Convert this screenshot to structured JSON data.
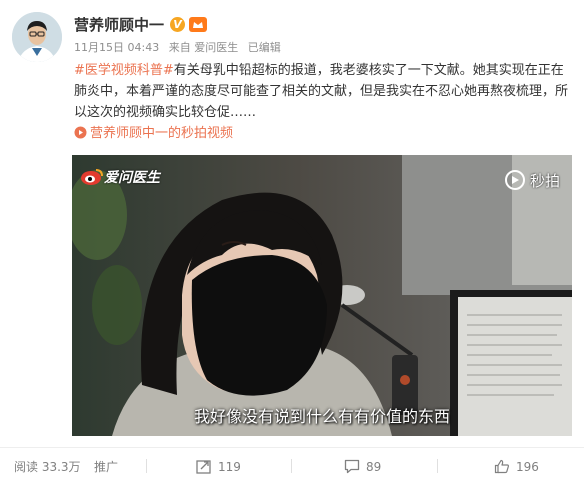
{
  "author": {
    "name": "营养师顾中一",
    "verified_badge": "V"
  },
  "meta": {
    "time": "11月15日 04:43",
    "source": "来自 爱问医生",
    "edited": "已编辑"
  },
  "post": {
    "tag": "#医学视频科普#",
    "text": "有关母乳中铅超标的报道，我老婆核实了一下文献。她其实现在正在肺炎中，本着严谨的态度尽可能查了相关的文献，但是我实在不忍心她再熬夜梳理，所以这次的视频确实比较仓促……",
    "video_link": "营养师顾中一的秒拍视频"
  },
  "video": {
    "watermark_left": "爱问医生",
    "watermark_right": "秒拍",
    "subtitle": "我好像没有说到什么有有价值的东西"
  },
  "footer": {
    "views": "阅读 33.3万",
    "promote": "推广",
    "reposts": "119",
    "comments": "89",
    "likes": "196"
  },
  "colors": {
    "link": "#eb7350",
    "meta": "#8e8e8e",
    "verified": "#f6a623"
  }
}
